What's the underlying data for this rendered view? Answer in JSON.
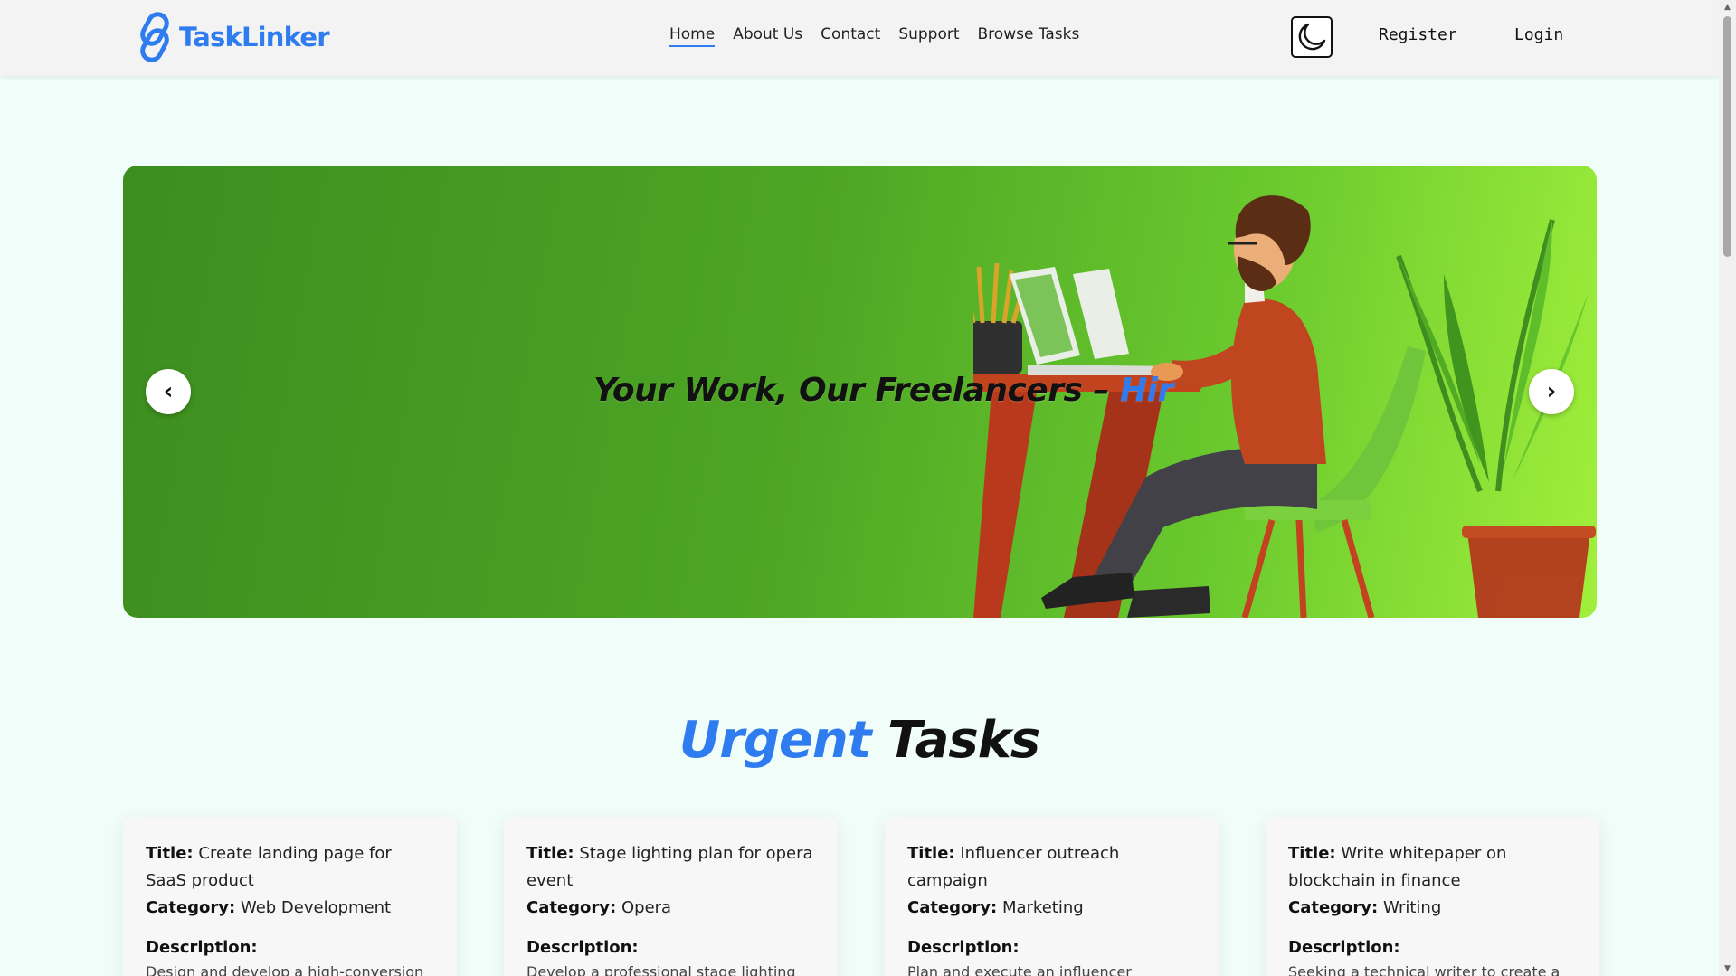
{
  "brand": {
    "name": "TaskLinker",
    "color": "#2e7cf0"
  },
  "nav": {
    "links": [
      {
        "label": "Home",
        "active": true
      },
      {
        "label": "About Us"
      },
      {
        "label": "Contact"
      },
      {
        "label": "Support"
      },
      {
        "label": "Browse Tasks"
      }
    ],
    "theme_toggle_icon": "moon-icon",
    "register_label": "Register",
    "login_label": "Login"
  },
  "hero": {
    "headline_main": "Your Work, Our Freelancers – ",
    "headline_accent": "Hir",
    "prev_label": "‹",
    "next_label": "›"
  },
  "urgent": {
    "title_accent": "Urgent",
    "title_rest": " Tasks",
    "field_labels": {
      "title": "Title:",
      "category": "Category:",
      "description": "Description:"
    },
    "tasks": [
      {
        "title": "Create landing page for SaaS product",
        "category": "Web Development",
        "description": "Design and develop a high-conversion"
      },
      {
        "title": "Stage lighting plan for opera event",
        "category": "Opera",
        "description": "Develop a professional stage lighting"
      },
      {
        "title": "Influencer outreach campaign",
        "category": "Marketing",
        "description": "Plan and execute an influencer outreach campaign for a fitness apparel brand."
      },
      {
        "title": "Write whitepaper on blockchain in finance",
        "category": "Writing",
        "description": "Seeking a technical writer to create a"
      }
    ]
  },
  "scrollbar": {
    "up_arrow": "▲",
    "down_arrow": "▼"
  }
}
